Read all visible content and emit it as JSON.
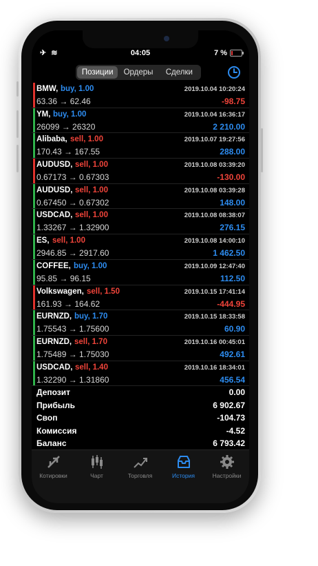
{
  "status": {
    "time": "04:05",
    "battery": "7 %"
  },
  "segments": [
    "Позиции",
    "Ордеры",
    "Сделки"
  ],
  "rows": [
    {
      "symbol": "BMW,",
      "dir": "buy",
      "vol": "1.00",
      "time": "2019.10.04 10:20:24",
      "prices": "63.36 → 62.46",
      "profit": "-98.75",
      "neg": true
    },
    {
      "symbol": "YM,",
      "dir": "buy",
      "vol": "1.00",
      "time": "2019.10.04 16:36:17",
      "prices": "26099 → 26320",
      "profit": "2 210.00",
      "neg": false
    },
    {
      "symbol": "Alibaba,",
      "dir": "sell",
      "vol": "1.00",
      "time": "2019.10.07 19:27:56",
      "prices": "170.43 → 167.55",
      "profit": "288.00",
      "neg": false
    },
    {
      "symbol": "AUDUSD,",
      "dir": "sell",
      "vol": "1.00",
      "time": "2019.10.08 03:39:20",
      "prices": "0.67173 → 0.67303",
      "profit": "-130.00",
      "neg": true
    },
    {
      "symbol": "AUDUSD,",
      "dir": "sell",
      "vol": "1.00",
      "time": "2019.10.08 03:39:28",
      "prices": "0.67450 → 0.67302",
      "profit": "148.00",
      "neg": false
    },
    {
      "symbol": "USDCAD,",
      "dir": "sell",
      "vol": "1.00",
      "time": "2019.10.08 08:38:07",
      "prices": "1.33267 → 1.32900",
      "profit": "276.15",
      "neg": false
    },
    {
      "symbol": "ES,",
      "dir": "sell",
      "vol": "1.00",
      "time": "2019.10.08 14:00:10",
      "prices": "2946.85 → 2917.60",
      "profit": "1 462.50",
      "neg": false
    },
    {
      "symbol": "COFFEE,",
      "dir": "buy",
      "vol": "1.00",
      "time": "2019.10.09 12:47:40",
      "prices": "95.85 → 96.15",
      "profit": "112.50",
      "neg": false
    },
    {
      "symbol": "Volkswagen,",
      "dir": "sell",
      "vol": "1.50",
      "time": "2019.10.15 17:41:14",
      "prices": "161.93 → 164.62",
      "profit": "-444.95",
      "neg": true
    },
    {
      "symbol": "EURNZD,",
      "dir": "buy",
      "vol": "1.70",
      "time": "2019.10.15 18:33:58",
      "prices": "1.75543 → 1.75600",
      "profit": "60.90",
      "neg": false
    },
    {
      "symbol": "EURNZD,",
      "dir": "sell",
      "vol": "1.70",
      "time": "2019.10.16 00:45:01",
      "prices": "1.75489 → 1.75030",
      "profit": "492.61",
      "neg": false
    },
    {
      "symbol": "USDCAD,",
      "dir": "sell",
      "vol": "1.40",
      "time": "2019.10.16 18:34:01",
      "prices": "1.32290 → 1.31860",
      "profit": "456.54",
      "neg": false
    }
  ],
  "summary": [
    {
      "label": "Депозит",
      "value": "0.00"
    },
    {
      "label": "Прибыль",
      "value": "6 902.67"
    },
    {
      "label": "Своп",
      "value": "-104.73"
    },
    {
      "label": "Комиссия",
      "value": "-4.52"
    },
    {
      "label": "Баланс",
      "value": "6 793.42"
    }
  ],
  "tabs": [
    {
      "label": "Котировки",
      "icon": "quotes-icon"
    },
    {
      "label": "Чарт",
      "icon": "chart-icon"
    },
    {
      "label": "Торговля",
      "icon": "trade-icon"
    },
    {
      "label": "История",
      "icon": "history-icon",
      "active": true
    },
    {
      "label": "Настройки",
      "icon": "settings-icon"
    }
  ],
  "colors": {
    "positive": "#2d8cf0",
    "negative": "#f0443a",
    "profit_bar": "#2fb24a",
    "loss_bar": "#e0322c"
  }
}
